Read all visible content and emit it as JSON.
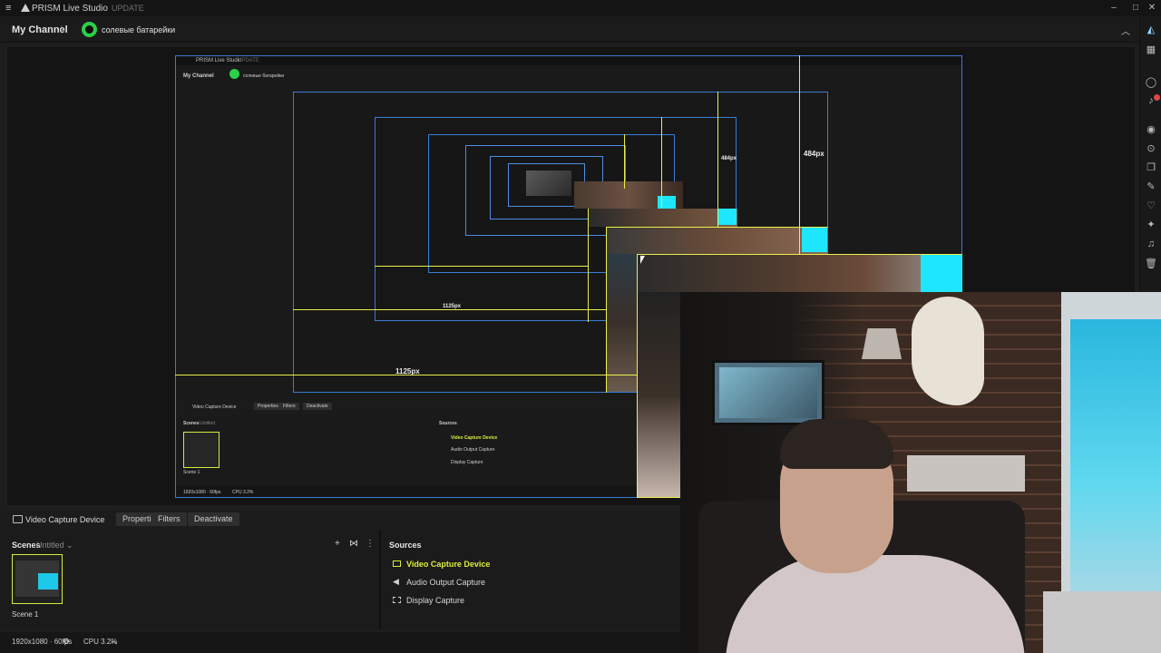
{
  "app": {
    "title": "PRISM Live Studio",
    "update_tag": "UPDATE",
    "window_controls": [
      "minimize-icon",
      "maximize-icon",
      "close-icon"
    ]
  },
  "channel": {
    "name": "My Channel",
    "account": "солевые батарейки"
  },
  "right_toolbar": {
    "icons": [
      "prism-logo-icon",
      "layout-icon",
      "chat-icon",
      "bell-icon",
      "camera-icon",
      "virtual-camera-icon",
      "layers-icon",
      "effects-icon",
      "heart-icon",
      "sticker-icon",
      "music-icon",
      "trash-icon"
    ],
    "notification_badge": "1"
  },
  "preview": {
    "measure_width_label": "1125px",
    "measure_height_label": "484px",
    "nested": {
      "title": "PRISM Live Studio",
      "update_tag": "UPDATE",
      "channel_name": "My Channel",
      "account": "солевые батарейки",
      "source_name": "Video Capture Device",
      "buttons": [
        "Properties",
        "Filters",
        "Deactivate"
      ],
      "scenes_title": "Scenes",
      "scenes_sub": "Untitled",
      "scene_label": "Scene 1",
      "sources_title": "Sources",
      "sources": [
        "Video Capture Device",
        "Audio Output Capture",
        "Display Capture"
      ],
      "status_res": "1920x1080 · 60fps",
      "status_cpu": "CPU 3.2%"
    }
  },
  "source_bar": {
    "source_name": "Video Capture Device",
    "properties_label": "Properties",
    "filters_label": "Filters",
    "deactivate_label": "Deactivate"
  },
  "scenes": {
    "title": "Scenes",
    "collection": "Untitled",
    "items": [
      {
        "label": "Scene 1"
      }
    ]
  },
  "sources": {
    "title": "Sources",
    "items": [
      {
        "label": "Video Capture Device",
        "icon": "camera-icon",
        "active": true
      },
      {
        "label": "Audio Output Capture",
        "icon": "speaker-icon",
        "active": false
      },
      {
        "label": "Display Capture",
        "icon": "display-icon",
        "active": false
      }
    ]
  },
  "status": {
    "resolution": "1920x1080 · 60fps",
    "cpu": "CPU 3.2%"
  },
  "colors": {
    "accent_yellow": "#d9ee3c",
    "selection_blue": "#3a7bd5",
    "cyan": "#1ee6ff",
    "background": "#1e1e1e"
  }
}
